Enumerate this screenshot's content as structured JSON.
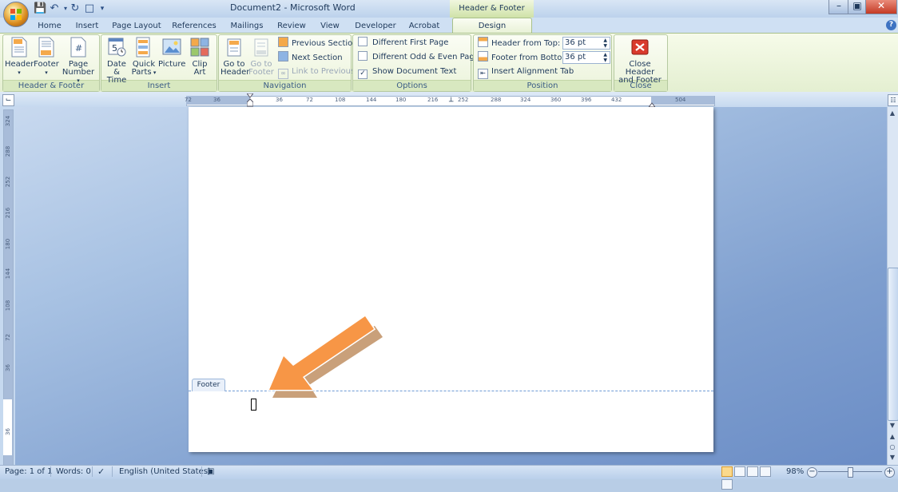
{
  "window": {
    "title": "Document2 - Microsoft Word",
    "context_tab_title": "Header & Footer Tools"
  },
  "tabs": [
    "Home",
    "Insert",
    "Page Layout",
    "References",
    "Mailings",
    "Review",
    "View",
    "Developer",
    "Acrobat"
  ],
  "active_tab": "Design",
  "ribbon": {
    "header_footer_group": {
      "label": "Header & Footer",
      "header": "Header",
      "footer": "Footer",
      "page_number_1": "Page",
      "page_number_2": "Number"
    },
    "insert_group": {
      "label": "Insert",
      "date_time_1": "Date",
      "date_time_2": "& Time",
      "quick_parts_1": "Quick",
      "quick_parts_2": "Parts",
      "picture": "Picture",
      "clip_art_1": "Clip",
      "clip_art_2": "Art"
    },
    "navigation_group": {
      "label": "Navigation",
      "go_to_header_1": "Go to",
      "go_to_header_2": "Header",
      "go_to_footer_1": "Go to",
      "go_to_footer_2": "Footer",
      "previous_section": "Previous Section",
      "next_section": "Next Section",
      "link_to_previous": "Link to Previous"
    },
    "options_group": {
      "label": "Options",
      "different_first_page": "Different First Page",
      "different_odd_even": "Different Odd & Even Pages",
      "show_document_text": "Show Document Text",
      "show_document_text_checked": true
    },
    "position_group": {
      "label": "Position",
      "header_from_top": "Header from Top:",
      "header_from_top_value": "36 pt",
      "footer_from_bottom": "Footer from Bottom:",
      "footer_from_bottom_value": "36 pt",
      "insert_alignment_tab": "Insert Alignment Tab"
    },
    "close_group": {
      "label": "Close",
      "close_1": "Close Header",
      "close_2": "and Footer"
    }
  },
  "ruler": {
    "horizontal_ticks": [
      "72",
      "36",
      "36",
      "72",
      "108",
      "144",
      "180",
      "216",
      "252",
      "288",
      "324",
      "360",
      "396",
      "432",
      "504"
    ],
    "vertical_ticks": [
      "324",
      "288",
      "252",
      "216",
      "180",
      "144",
      "108",
      "72",
      "36",
      "36"
    ]
  },
  "document": {
    "footer_label": "Footer"
  },
  "statusbar": {
    "page": "Page: 1 of 1",
    "words": "Words: 0",
    "language": "English (United States)",
    "zoom": "98%"
  },
  "colors": {
    "arrow_fill": "#f79646",
    "arrow_shadow": "#c9a07a",
    "close_red": "#d93a2c"
  }
}
